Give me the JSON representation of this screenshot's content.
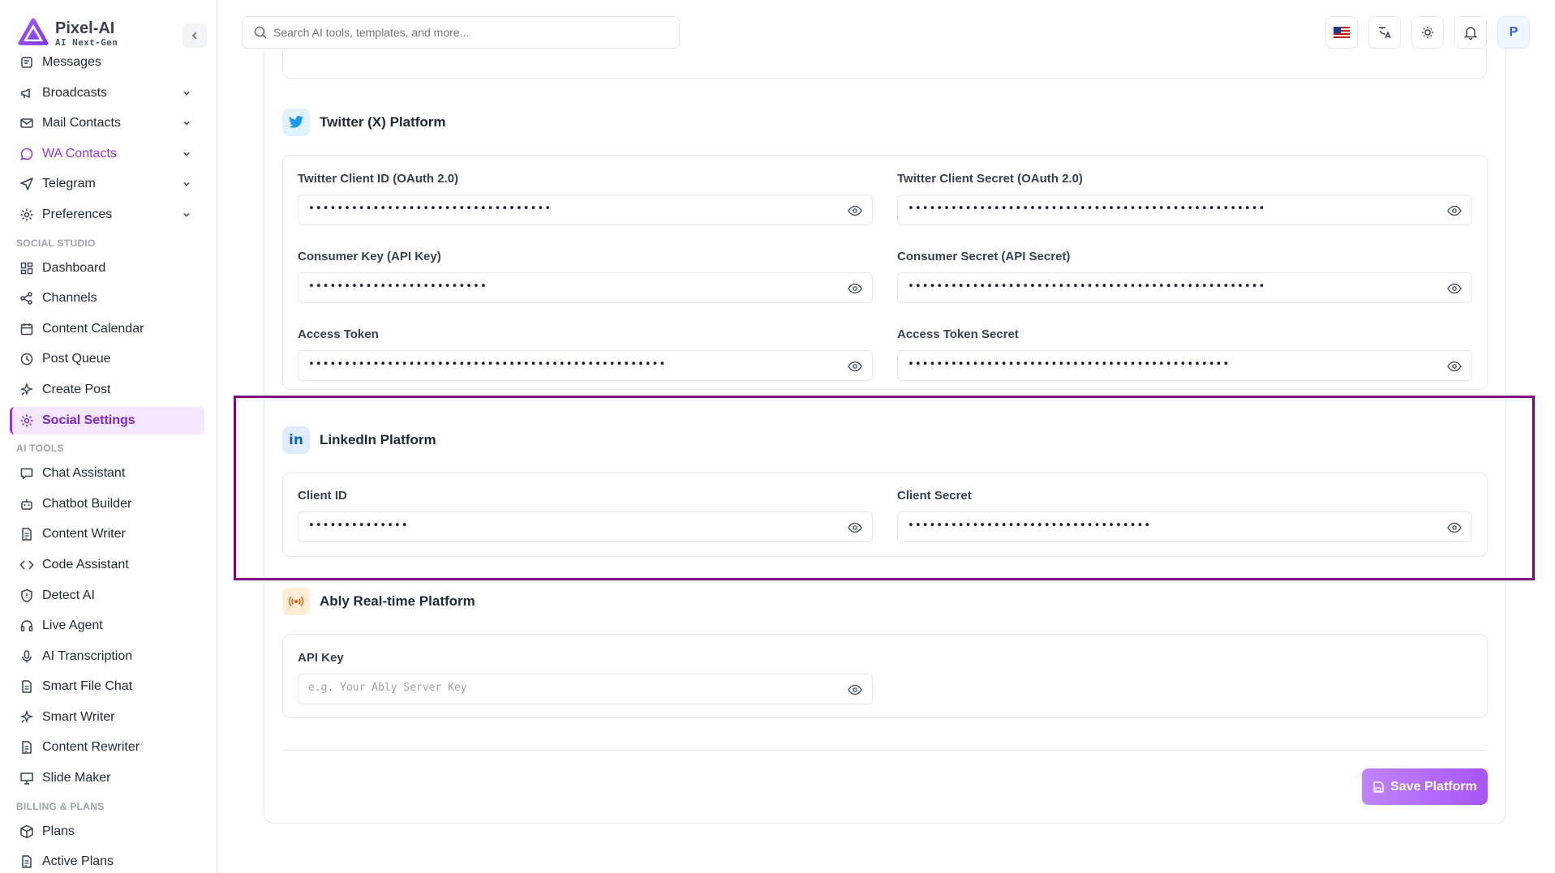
{
  "brand": {
    "name": "Pixel-AI",
    "tagline": "AI Next-Gen"
  },
  "sidebar": {
    "items_top": [
      {
        "label": "Messages",
        "icon": "message-icon",
        "chevron": false
      },
      {
        "label": "Broadcasts",
        "icon": "megaphone-icon",
        "chevron": true
      },
      {
        "label": "Mail Contacts",
        "icon": "mail-icon",
        "chevron": true
      },
      {
        "label": "WA Contacts",
        "icon": "chat-bubble-icon",
        "chevron": true,
        "active": true
      },
      {
        "label": "Telegram",
        "icon": "send-icon",
        "chevron": true
      },
      {
        "label": "Preferences",
        "icon": "gear-icon",
        "chevron": true
      }
    ],
    "section_social": "SOCIAL STUDIO",
    "items_social": [
      {
        "label": "Dashboard",
        "icon": "grid-icon"
      },
      {
        "label": "Channels",
        "icon": "share-icon"
      },
      {
        "label": "Content Calendar",
        "icon": "calendar-icon"
      },
      {
        "label": "Post Queue",
        "icon": "clock-icon"
      },
      {
        "label": "Create Post",
        "icon": "sparkle-icon"
      },
      {
        "label": "Social Settings",
        "icon": "gear-icon",
        "selected": true
      }
    ],
    "section_ai": "AI TOOLS",
    "items_ai": [
      {
        "label": "Chat Assistant",
        "icon": "chat-icon"
      },
      {
        "label": "Chatbot Builder",
        "icon": "bot-icon"
      },
      {
        "label": "Content Writer",
        "icon": "document-icon"
      },
      {
        "label": "Code Assistant",
        "icon": "code-icon"
      },
      {
        "label": "Detect AI",
        "icon": "shield-icon"
      },
      {
        "label": "Live Agent",
        "icon": "headset-icon"
      },
      {
        "label": "AI Transcription",
        "icon": "microphone-icon"
      },
      {
        "label": "Smart File Chat",
        "icon": "file-icon"
      },
      {
        "label": "Smart Writer",
        "icon": "sparkle-icon"
      },
      {
        "label": "Content Rewriter",
        "icon": "document-icon"
      },
      {
        "label": "Slide Maker",
        "icon": "presentation-icon"
      }
    ],
    "section_billing": "BILLING & PLANS",
    "items_billing": [
      {
        "label": "Plans",
        "icon": "package-icon"
      },
      {
        "label": "Active Plans",
        "icon": "document-icon"
      }
    ]
  },
  "topbar": {
    "search_placeholder": "Search AI tools, templates, and more...",
    "avatar_initial": "P"
  },
  "twitter": {
    "title": "Twitter (X) Platform",
    "fields": [
      {
        "label": "Twitter Client ID (OAuth 2.0)",
        "value": "••••••••••••••••••••••••••••••••••"
      },
      {
        "label": "Twitter Client Secret (OAuth 2.0)",
        "value": "••••••••••••••••••••••••••••••••••••••••••••••••••"
      },
      {
        "label": "Consumer Key (API Key)",
        "value": "•••••••••••••••••••••••••"
      },
      {
        "label": "Consumer Secret (API Secret)",
        "value": "••••••••••••••••••••••••••••••••••••••••••••••••••"
      },
      {
        "label": "Access Token",
        "value": "••••••••••••••••••••••••••••••••••••••••••••••••••"
      },
      {
        "label": "Access Token Secret",
        "value": "•••••••••••••••••••••••••••••••••••••••••••••"
      }
    ]
  },
  "linkedin": {
    "title": "LinkedIn Platform",
    "fields": [
      {
        "label": "Client ID",
        "value": "••••••••••••••"
      },
      {
        "label": "Client Secret",
        "value": "••••••••••••••••••••••••••••••••••"
      }
    ]
  },
  "ably": {
    "title": "Ably Real-time Platform",
    "fields": [
      {
        "label": "API Key",
        "value": "",
        "placeholder": "e.g. Your Ably Server Key"
      }
    ]
  },
  "actions": {
    "save_label": "Save Platform"
  },
  "colors": {
    "accent": "#a855f7",
    "highlight_border": "#800080",
    "twitter_blue": "#1d9bf0",
    "linkedin_blue": "#0a66c2",
    "ably_orange": "#ff5416"
  }
}
